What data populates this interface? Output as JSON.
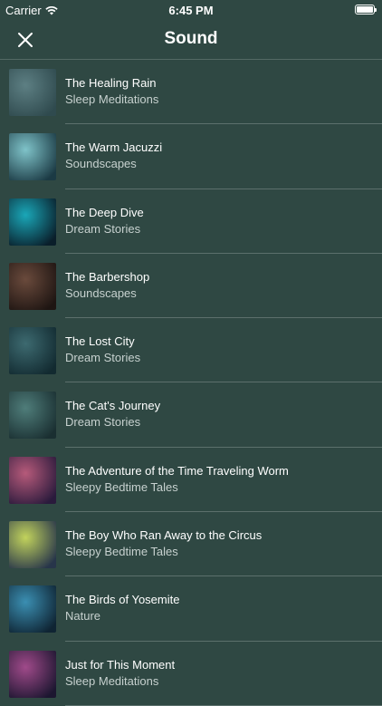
{
  "status_bar": {
    "carrier": "Carrier",
    "time": "6:45 PM"
  },
  "nav": {
    "title": "Sound",
    "close_icon": "close-icon"
  },
  "items": [
    {
      "title": "The Healing Rain",
      "subtitle": "Sleep Meditations",
      "thumb": [
        "#5d7f83",
        "#2f4a4e"
      ]
    },
    {
      "title": "The Warm Jacuzzi",
      "subtitle": "Soundscapes",
      "thumb": [
        "#7fc3c9",
        "#1b3a44"
      ]
    },
    {
      "title": "The Deep Dive",
      "subtitle": "Dream Stories",
      "thumb": [
        "#1aa7b8",
        "#0a1e2a"
      ]
    },
    {
      "title": "The Barbershop",
      "subtitle": "Soundscapes",
      "thumb": [
        "#6a4a3c",
        "#1e1512"
      ]
    },
    {
      "title": "The Lost City",
      "subtitle": "Dream Stories",
      "thumb": [
        "#3d6a70",
        "#122a30"
      ]
    },
    {
      "title": "The Cat's Journey",
      "subtitle": "Dream Stories",
      "thumb": [
        "#4f7d7a",
        "#1a2f31"
      ]
    },
    {
      "title": "The Adventure of the Time Traveling Worm",
      "subtitle": "Sleepy Bedtime Tales",
      "thumb": [
        "#b65a7a",
        "#2a1a3c"
      ]
    },
    {
      "title": "The Boy Who Ran Away to the Circus",
      "subtitle": "Sleepy Bedtime Tales",
      "thumb": [
        "#c2d35c",
        "#27354a"
      ]
    },
    {
      "title": "The Birds of Yosemite",
      "subtitle": "Nature",
      "thumb": [
        "#3b8fb2",
        "#0f2433"
      ]
    },
    {
      "title": "Just for This Moment",
      "subtitle": "Sleep Meditations",
      "thumb": [
        "#a04a8a",
        "#1c1630"
      ]
    }
  ]
}
